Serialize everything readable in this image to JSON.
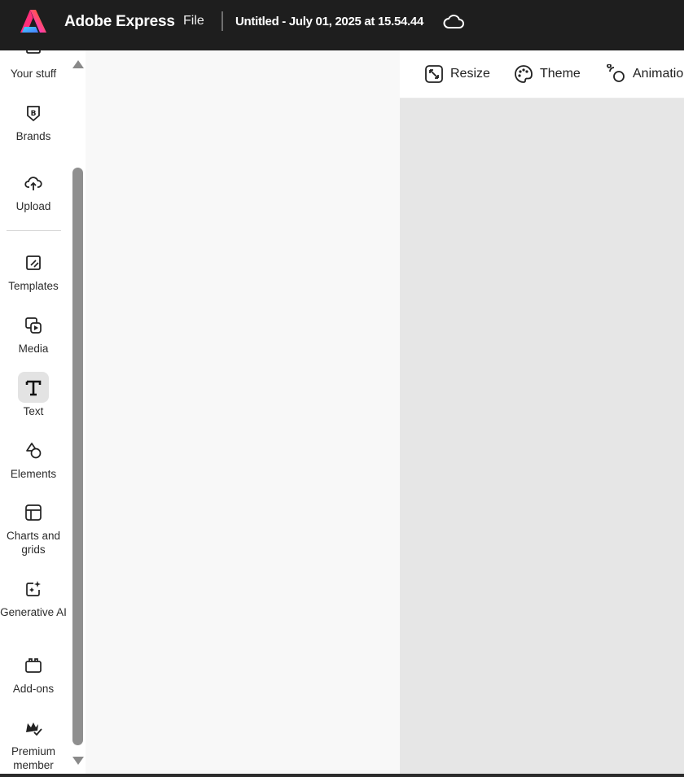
{
  "header": {
    "app_name": "Adobe Express",
    "file_menu": "File",
    "document_title": "Untitled - July 01, 2025 at 15.54.44"
  },
  "rail": {
    "items": [
      {
        "label": "Your stuff",
        "icon": "folder-icon"
      },
      {
        "label": "Brands",
        "icon": "brand-icon"
      },
      {
        "label": "Upload",
        "icon": "cloud-upload-icon"
      },
      {
        "label": "Templates",
        "icon": "templates-icon"
      },
      {
        "label": "Media",
        "icon": "media-icon"
      },
      {
        "label": "Text",
        "icon": "text-icon",
        "active": true
      },
      {
        "label": "Elements",
        "icon": "shapes-icon"
      },
      {
        "label": "Charts and grids",
        "icon": "grid-icon"
      },
      {
        "label": "Generative AI",
        "icon": "sparkle-icon"
      },
      {
        "label": "Add-ons",
        "icon": "addons-icon"
      },
      {
        "label": "Premium member",
        "icon": "crown-icon"
      }
    ]
  },
  "toolbar": {
    "resize": "Resize",
    "theme": "Theme",
    "animation": "Animation"
  }
}
